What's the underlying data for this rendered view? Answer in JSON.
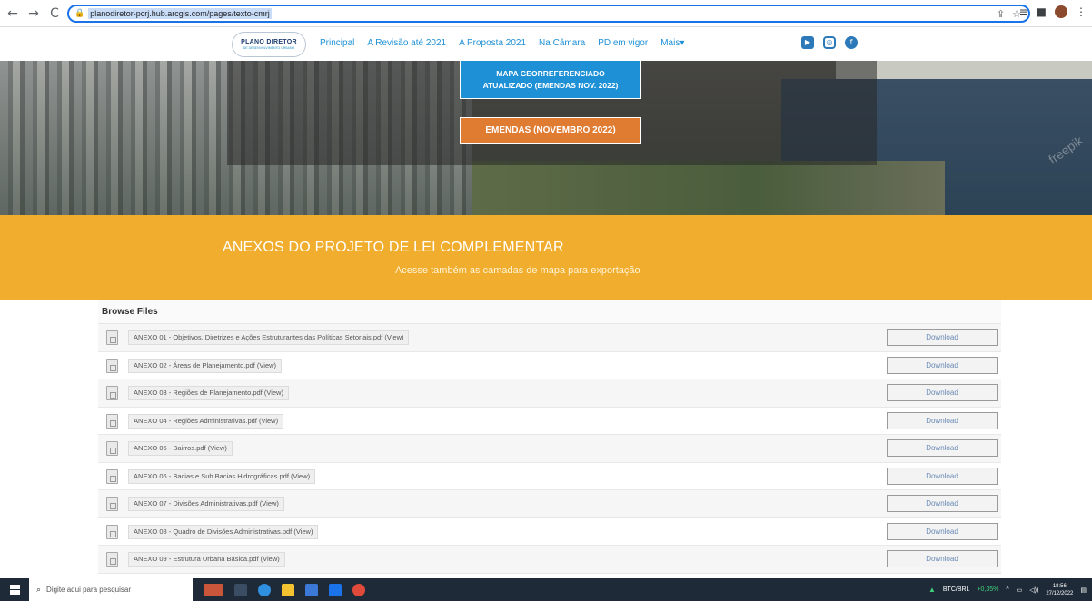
{
  "browser": {
    "back": "←",
    "forward": "→",
    "reload": "C",
    "url": "planodiretor-pcrj.hub.arcgis.com/pages/texto-cmrj",
    "lock": "🔒"
  },
  "site": {
    "logo_main": "PLANO DIRETOR",
    "logo_sub": "DE DESENVOLVIMENTO URBANO",
    "menu": [
      "Principal",
      "A Revisão até 2021",
      "A Proposta 2021",
      "Na Câmara",
      "PD em vigor",
      "Mais▾"
    ],
    "social": {
      "youtube": "▶",
      "instagram": "◎",
      "facebook": "f"
    }
  },
  "hero": {
    "map_button": "MAPA GEORREFERENCIADO ATUALIZADO (EMENDAS NOV. 2022)",
    "map_button_line1": "MAPA GEORREFERENCIADO",
    "map_button_line2": "ATUALIZADO (EMENDAS NOV. 2022)",
    "emendas_button": "EMENDAS (NOVEMBRO 2022)",
    "watermark": "freepik"
  },
  "band": {
    "title": "ANEXOS DO PROJETO DE LEI COMPLEMENTAR",
    "subtitle": "Acesse também as camadas de mapa para exportação"
  },
  "files": {
    "header": "Browse Files",
    "download_label": "Download",
    "items": [
      "ANEXO 01 - Objetivos, Diretrizes e Ações Estruturantes das Políticas Setoriais.pdf (View)",
      "ANEXO 02 - Áreas de Planejamento.pdf (View)",
      "ANEXO 03 - Regiões de Planejamento.pdf (View)",
      "ANEXO 04 - Regiões Administrativas.pdf (View)",
      "ANEXO 05 - Bairros.pdf (View)",
      "ANEXO 06 - Bacias e Sub Bacias Hidrográficas.pdf (View)",
      "ANEXO 07 - Divisões Administrativas.pdf (View)",
      "ANEXO 08 - Quadro de Divisões Administrativas.pdf (View)",
      "ANEXO 09 - Estrutura Urbana Básica.pdf (View)"
    ]
  },
  "taskbar": {
    "search_placeholder": "Digite aqui para pesquisar",
    "ticker_label": "BTC/BRL",
    "ticker_value": "+0,35%",
    "time": "18:56",
    "date": "27/12/2022"
  },
  "colors": {
    "accent_blue": "#1e90d6",
    "orange_band": "#f0ad2e",
    "emendas_orange": "#e07b32"
  }
}
